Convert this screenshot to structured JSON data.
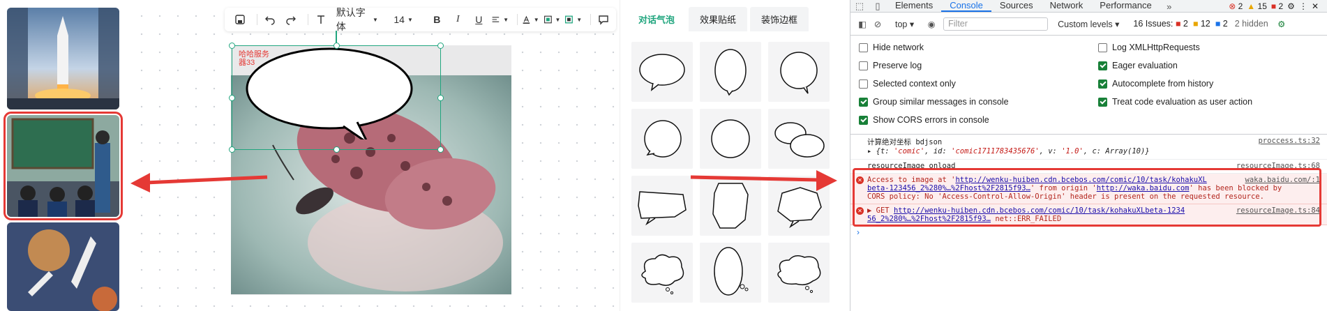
{
  "editor": {
    "font_family": "默认字体",
    "font_size": "14",
    "bubble_label_line1": "哈哈服务",
    "bubble_label_line2": "器33"
  },
  "panel": {
    "tabs": [
      {
        "label": "对话气泡",
        "active": true
      },
      {
        "label": "效果贴纸",
        "active": false
      },
      {
        "label": "装饰边框",
        "active": false
      }
    ]
  },
  "devtools": {
    "tabs": [
      {
        "label": "Elements",
        "active": false
      },
      {
        "label": "Console",
        "active": true
      },
      {
        "label": "Sources",
        "active": false
      },
      {
        "label": "Network",
        "active": false
      },
      {
        "label": "Performance",
        "active": false
      }
    ],
    "header_counts": {
      "errors": "2",
      "warnings": "15",
      "info": "2"
    },
    "filter": {
      "context": "top",
      "placeholder": "Filter",
      "levels": "Custom levels",
      "issues_label": "16 Issues:",
      "issues_errors": "2",
      "issues_warnings": "12",
      "issues_info": "2",
      "hidden": "2 hidden"
    },
    "options": {
      "hide_network": {
        "label": "Hide network",
        "checked": false
      },
      "preserve_log": {
        "label": "Preserve log",
        "checked": false
      },
      "selected_context": {
        "label": "Selected context only",
        "checked": false
      },
      "group_similar": {
        "label": "Group similar messages in console",
        "checked": true
      },
      "show_cors": {
        "label": "Show CORS errors in console",
        "checked": true
      },
      "log_xhr": {
        "label": "Log XMLHttpRequests",
        "checked": false
      },
      "eager_eval": {
        "label": "Eager evaluation",
        "checked": true
      },
      "autocomplete": {
        "label": "Autocomplete from history",
        "checked": true
      },
      "treat_code": {
        "label": "Treat code evaluation as user action",
        "checked": true
      }
    },
    "log": {
      "l1_text": "计算绝对坐标 bdjson",
      "l1_src": "proccess.ts:32",
      "l1_obj_prefix": "{t: ",
      "l1_obj_t": "'comic'",
      "l1_obj_mid1": ", id: ",
      "l1_obj_id": "'comic1711783435676'",
      "l1_obj_mid2": ", v: ",
      "l1_obj_v": "'1.0'",
      "l1_obj_suffix": ", c: Array(10)}",
      "l2_text": "resourceImage onload",
      "l2_src": "resourceImage.ts:68",
      "e1_pre": "Access to image at '",
      "e1_url": "http://wenku-huiben.cdn.bcebos.com/comic/10/task/kohakuXL",
      "e1_src": "waka.baidu.com/:1",
      "e1_url2": "beta-123456_2%280%…%2Fhost%2F2815f93…",
      "e1_mid": "' from origin '",
      "e1_origin": "http://waka.baidu.com",
      "e1_post": "' has been blocked by",
      "e1_line3": "CORS policy: No 'Access-Control-Allow-Origin' header is present on the requested resource.",
      "e2_pre": "▶ GET ",
      "e2_url": "http://wenku-huiben.cdn.bcebos.com/comic/10/task/kohakuXLbeta-1234",
      "e2_src": "resourceImage.ts:84",
      "e2_url2": "56_2%280%…%2Fhost%2F2815f93…",
      "e2_post": " net::ERR_FAILED",
      "prompt": "›"
    }
  }
}
